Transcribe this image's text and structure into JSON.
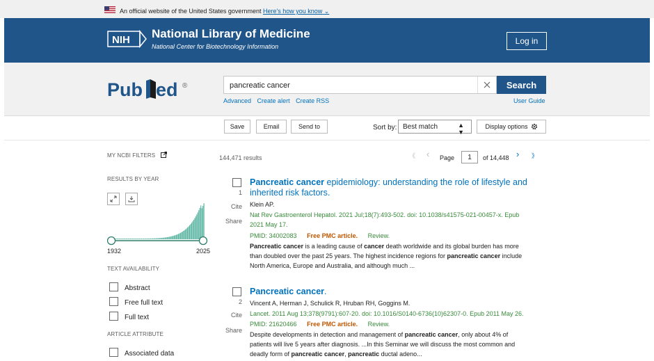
{
  "gov_banner": {
    "text": "An official website of the United States government",
    "link": "Here's how you know"
  },
  "header": {
    "title": "National Library of Medicine",
    "subtitle": "National Center for Biotechnology Information",
    "logo_text": "NIH",
    "login": "Log in"
  },
  "search": {
    "logo": "PubMed",
    "value": "pancreatic cancer",
    "button": "Search",
    "links": [
      "Advanced",
      "Create alert",
      "Create RSS"
    ],
    "user_guide": "User Guide"
  },
  "toolbar": {
    "save": "Save",
    "email": "Email",
    "send_to": "Send to",
    "sort_label": "Sort by:",
    "sort_value": "Best match",
    "display_options": "Display options"
  },
  "sidebar": {
    "my_ncbi": "MY NCBI FILTERS",
    "results_by_year": "RESULTS BY YEAR",
    "year_start": "1932",
    "year_end": "2025",
    "text_availability": "TEXT AVAILABILITY",
    "text_filters": [
      "Abstract",
      "Free full text",
      "Full text"
    ],
    "article_attribute": "ARTICLE ATTRIBUTE",
    "attr_filters": [
      "Associated data"
    ]
  },
  "results": {
    "count": "144,471 results",
    "page_label": "Page",
    "page": "1",
    "of_pages": "of 14,448",
    "items": [
      {
        "num": "1",
        "title_bold": "Pancreatic cancer",
        "title_rest": " epidemiology: understanding the role of lifestyle and",
        "title_rest2": "inherited risk factors.",
        "authors": "Klein AP.",
        "citation1": "Nat Rev Gastroenterol Hepatol. 2021 Jul;18(7):493-502. doi: 10.1038/s41575-021-00457-x. Epub",
        "citation2": "2021 May 17.",
        "pmid": "PMID: 34002083",
        "free": "Free PMC article.",
        "type": "Review.",
        "cite": "Cite",
        "share": "Share",
        "s1a": "Pancreatic cancer",
        "s1b": " is a leading cause of ",
        "s1c": "cancer",
        "s1d": " death worldwide and its global burden has more",
        "s2": "than doubled over the past 25 years. The highest incidence regions for ",
        "s2b": "pancreatic cancer",
        "s2c": " include",
        "s3": "North America, Europe and Australia, and although much ..."
      },
      {
        "num": "2",
        "title_bold": "Pancreatic cancer",
        "title_rest": ".",
        "authors": "Vincent A, Herman J, Schulick R, Hruban RH, Goggins M.",
        "citation1": "Lancet. 2011 Aug 13;378(9791):607-20. doi: 10.1016/S0140-6736(10)62307-0. Epub 2011 May 26.",
        "pmid": "PMID: 21620466",
        "free": "Free PMC article.",
        "type": "Review.",
        "cite": "Cite",
        "share": "Share",
        "s1": "Despite developments in detection and management of ",
        "s1b": "pancreatic cancer",
        "s1c": ", only about 4% of",
        "s2": "patients will live 5 years after diagnosis. ...In this Seminar we will discuss the most common and",
        "s3a": "deadly form of ",
        "s3b": "pancreatic cancer",
        "s3c": ", ",
        "s3d": "pancreatic",
        "s3e": " ductal adeno..."
      }
    ]
  },
  "colors": {
    "header_blue": "#20558a",
    "link_blue": "#0071bc",
    "citation_green": "#388a3a",
    "free_orange": "#c05600",
    "histogram_teal": "#5bb5a2"
  }
}
